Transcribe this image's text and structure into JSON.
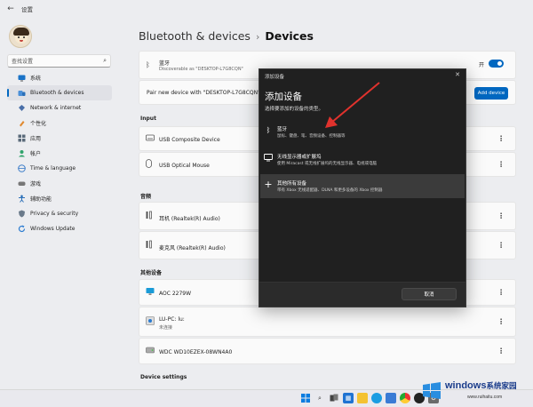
{
  "window": {
    "title": "设置",
    "back_icon": "back-arrow-icon"
  },
  "sidebar": {
    "search_placeholder": "查找设置",
    "items": [
      {
        "label": "系统",
        "icon": "monitor-icon"
      },
      {
        "label": "Bluetooth & devices",
        "icon": "bluetooth-devices-icon",
        "active": true
      },
      {
        "label": "Network & internet",
        "icon": "network-icon"
      },
      {
        "label": "个性化",
        "icon": "brush-icon"
      },
      {
        "label": "应用",
        "icon": "apps-icon"
      },
      {
        "label": "帐户",
        "icon": "account-icon"
      },
      {
        "label": "Time & language",
        "icon": "globe-icon"
      },
      {
        "label": "游戏",
        "icon": "game-icon"
      },
      {
        "label": "辅助功能",
        "icon": "accessibility-icon"
      },
      {
        "label": "Privacy & security",
        "icon": "shield-icon"
      },
      {
        "label": "Windows Update",
        "icon": "update-icon"
      }
    ]
  },
  "header": {
    "parent": "Bluetooth & devices",
    "separator": "›",
    "current": "Devices"
  },
  "bluetooth_card": {
    "title": "蓝牙",
    "subtitle": "Discoverable as \"DESKTOP-L7G8CQN\"",
    "toggle_label": "开",
    "toggle_on": true
  },
  "pair_card": {
    "text": "Pair new device with \"DESKTOP-L7G8CQN\"",
    "button": "Add device"
  },
  "sections": {
    "input": "Input",
    "audio": "音频",
    "other": "其他设备",
    "settings": "Device settings"
  },
  "devices": {
    "input": [
      {
        "name": "USB Composite Device",
        "icon": "keyboard-icon"
      },
      {
        "name": "USB Optical Mouse",
        "icon": "mouse-icon"
      }
    ],
    "audio": [
      {
        "name": "耳机 (Realtek(R) Audio)",
        "icon": "speaker-icon"
      },
      {
        "name": "麦克风 (Realtek(R) Audio)",
        "icon": "speaker-icon"
      }
    ],
    "other": [
      {
        "name": "AOC 2279W",
        "sub": "",
        "icon": "monitor-icon"
      },
      {
        "name": "LU-PC: lu:",
        "sub": "未连接",
        "icon": "media-device-icon"
      },
      {
        "name": "WDC WD10EZEX-08WN4A0",
        "sub": "",
        "icon": "drive-icon"
      }
    ]
  },
  "dialog": {
    "title": "添加设备",
    "heading": "添加设备",
    "subtitle": "选择要添加的设备的类型。",
    "options": [
      {
        "title": "蓝牙",
        "desc": "鼠标、键盘、笔、音频设备、控制器等",
        "icon": "bluetooth-icon"
      },
      {
        "title": "无线显示器或扩展坞",
        "desc": "使用 Miracast 或无线扩展坞的无线显示器、电视或电脑",
        "icon": "display-icon"
      },
      {
        "title": "其他所有设备",
        "desc": "带有 Xbox 无线适配器、DLNA 和更多设备的 Xbox 控制器",
        "icon": "plus-icon",
        "highlighted": true
      }
    ],
    "cancel": "取消",
    "annotation_color": "#e0322d"
  },
  "colors": {
    "accent": "#0067c0",
    "dialog_bg": "#202020"
  },
  "watermark": {
    "title_en": "windows",
    "title_cn": "系统家园",
    "url": "www.ruihaitu.com"
  }
}
